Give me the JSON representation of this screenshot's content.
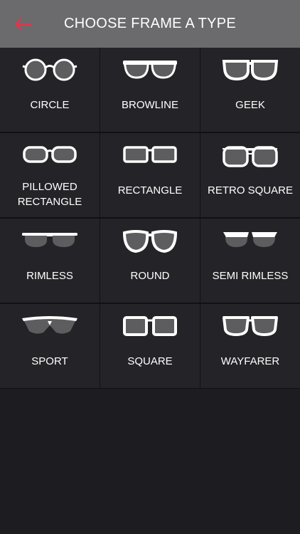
{
  "header": {
    "title": "CHOOSE FRAME A TYPE",
    "back_icon": "arrow-left-icon",
    "accent_color": "#e0354a"
  },
  "frames": [
    {
      "label": "CIRCLE",
      "icon": "circle-glasses-icon"
    },
    {
      "label": "BROWLINE",
      "icon": "browline-glasses-icon"
    },
    {
      "label": "GEEK",
      "icon": "geek-glasses-icon"
    },
    {
      "label": "PILLOWED\nRECTANGLE",
      "icon": "pillowed-rectangle-glasses-icon"
    },
    {
      "label": "RECTANGLE",
      "icon": "rectangle-glasses-icon"
    },
    {
      "label": "RETRO SQUARE",
      "icon": "retro-square-glasses-icon"
    },
    {
      "label": "RIMLESS",
      "icon": "rimless-glasses-icon"
    },
    {
      "label": "ROUND",
      "icon": "round-glasses-icon"
    },
    {
      "label": "SEMI RIMLESS",
      "icon": "semi-rimless-glasses-icon"
    },
    {
      "label": "SPORT",
      "icon": "sport-glasses-icon"
    },
    {
      "label": "SQUARE",
      "icon": "square-glasses-icon"
    },
    {
      "label": "WAYFARER",
      "icon": "wayfarer-glasses-icon"
    }
  ]
}
